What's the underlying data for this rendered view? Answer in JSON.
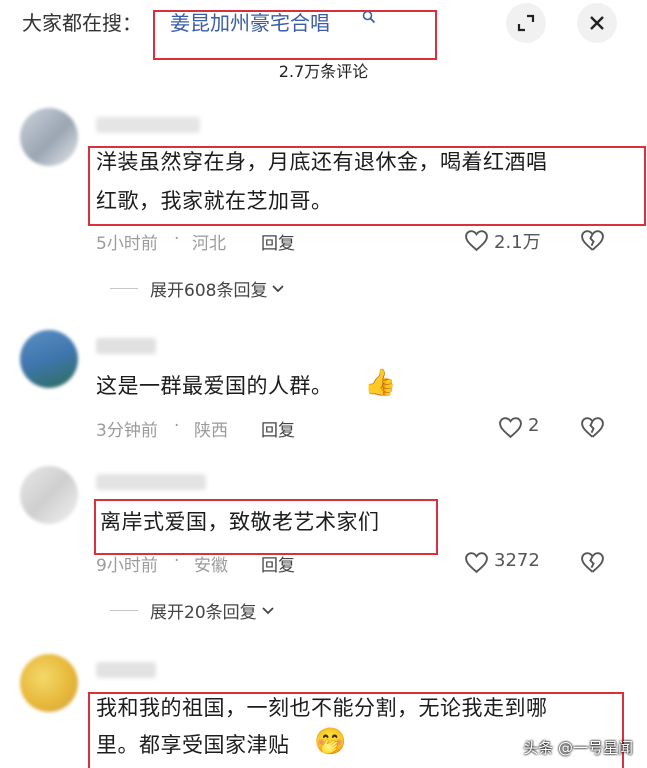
{
  "search": {
    "prefix": "大家都在搜：",
    "term": "姜昆加州豪宅合唱",
    "search_icon": "search-icon"
  },
  "header_buttons": {
    "collapse_icon": "collapse-icon",
    "close_icon": "close-icon"
  },
  "comment_count": "2.7万条评论",
  "comments": [
    {
      "text_line1": "洋装虽然穿在身，月底还有退休金，喝着红酒唱",
      "text_line2": "红歌，我家就在芝加哥。",
      "time": "5小时前",
      "location": "河北",
      "reply": "回复",
      "likes": "2.1万",
      "expand": "展开608条回复"
    },
    {
      "text_line1": "这是一群最爱国的人群。",
      "emoji": "👍",
      "time": "3分钟前",
      "location": "陕西",
      "reply": "回复",
      "likes": "2"
    },
    {
      "text_line1": "离岸式爱国，致敬老艺术家们",
      "time": "9小时前",
      "location": "安徽",
      "reply": "回复",
      "likes": "3272",
      "expand": "展开20条回复"
    },
    {
      "text_line1": "我和我的祖国，一刻也不能分割，无论我走到哪",
      "text_line2": "里。都享受国家津贴",
      "emoji": "🤭"
    }
  ],
  "watermark": "头条 @一号星闻",
  "colors": {
    "highlight_box": "#d9303a",
    "search_term": "#3b5ca8",
    "meta_text": "#9b9b9b"
  }
}
